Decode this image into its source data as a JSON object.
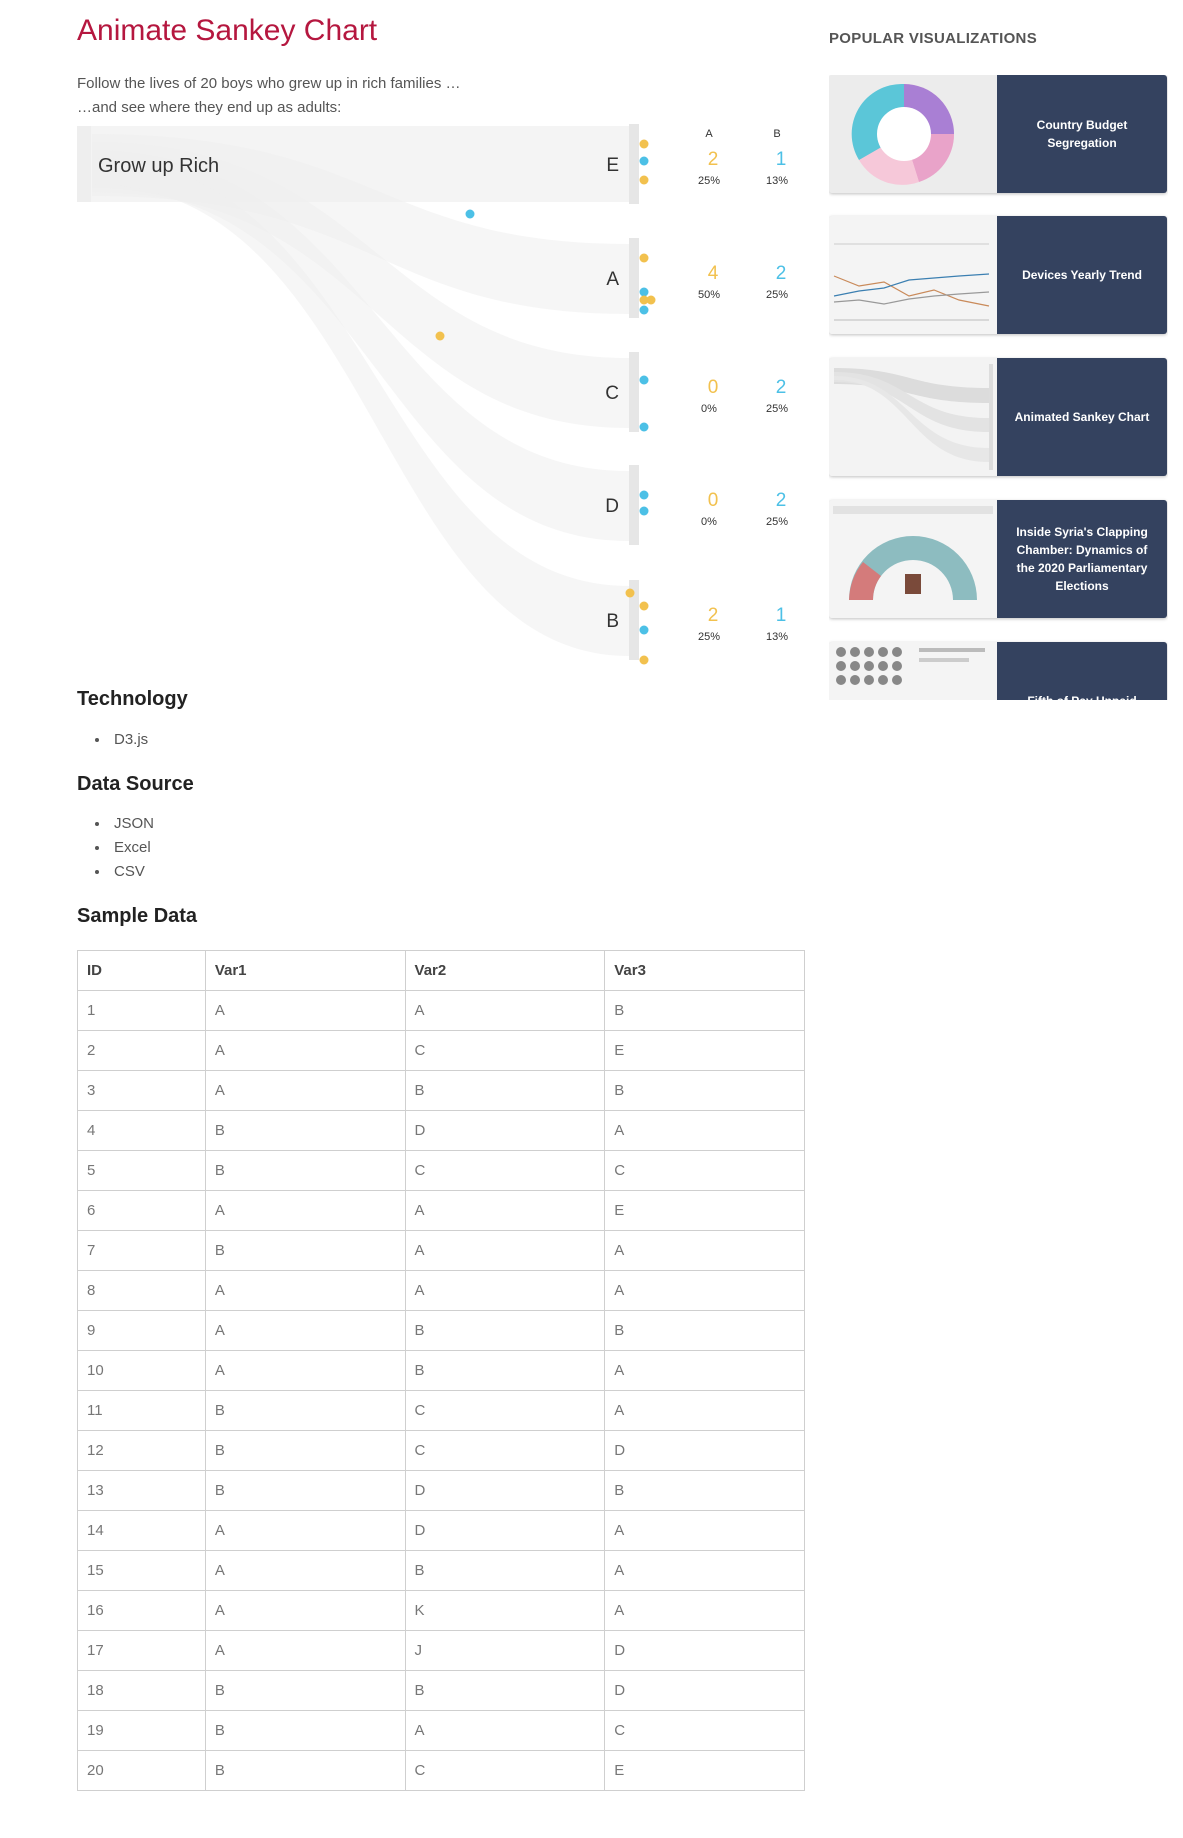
{
  "page": {
    "title": "Animate Sankey Chart",
    "intro_line1": "Follow the lives of 20 boys who grew up in rich families …",
    "intro_line2": "…and see where they end up as adults:"
  },
  "colors": {
    "title": "#b5173f",
    "series_a": "#f2c14e",
    "series_b": "#4cc0e6",
    "card_label_bg": "#34425f"
  },
  "chart_data": {
    "type": "sankey",
    "source": {
      "label": "Grow up Rich"
    },
    "legend": [
      "A",
      "B"
    ],
    "targets": [
      {
        "label": "E",
        "a_count": "2",
        "a_pct": "25%",
        "b_count": "1",
        "b_pct": "13%"
      },
      {
        "label": "A",
        "a_count": "4",
        "a_pct": "50%",
        "b_count": "2",
        "b_pct": "25%"
      },
      {
        "label": "C",
        "a_count": "0",
        "a_pct": "0%",
        "b_count": "2",
        "b_pct": "25%"
      },
      {
        "label": "D",
        "a_count": "0",
        "a_pct": "0%",
        "b_count": "2",
        "b_pct": "25%"
      },
      {
        "label": "B",
        "a_count": "2",
        "a_pct": "25%",
        "b_count": "1",
        "b_pct": "13%"
      }
    ]
  },
  "technology": {
    "heading": "Technology",
    "items": [
      "D3.js"
    ]
  },
  "data_source": {
    "heading": "Data Source",
    "items": [
      "JSON",
      "Excel",
      "CSV"
    ]
  },
  "sample": {
    "heading": "Sample Data",
    "columns": [
      "ID",
      "Var1",
      "Var2",
      "Var3"
    ],
    "rows": [
      [
        "1",
        "A",
        "A",
        "B"
      ],
      [
        "2",
        "A",
        "C",
        "E"
      ],
      [
        "3",
        "A",
        "B",
        "B"
      ],
      [
        "4",
        "B",
        "D",
        "A"
      ],
      [
        "5",
        "B",
        "C",
        "C"
      ],
      [
        "6",
        "A",
        "A",
        "E"
      ],
      [
        "7",
        "B",
        "A",
        "A"
      ],
      [
        "8",
        "A",
        "A",
        "A"
      ],
      [
        "9",
        "A",
        "B",
        "B"
      ],
      [
        "10",
        "A",
        "B",
        "A"
      ],
      [
        "11",
        "B",
        "C",
        "A"
      ],
      [
        "12",
        "B",
        "C",
        "D"
      ],
      [
        "13",
        "B",
        "D",
        "B"
      ],
      [
        "14",
        "A",
        "D",
        "A"
      ],
      [
        "15",
        "A",
        "B",
        "A"
      ],
      [
        "16",
        "A",
        "K",
        "A"
      ],
      [
        "17",
        "A",
        "J",
        "D"
      ],
      [
        "18",
        "B",
        "B",
        "D"
      ],
      [
        "19",
        "B",
        "A",
        "C"
      ],
      [
        "20",
        "B",
        "C",
        "E"
      ]
    ]
  },
  "sidebar": {
    "title": "POPULAR VISUALIZATIONS",
    "cards": [
      {
        "title": "Country Budget Segregation",
        "thumb": "donut"
      },
      {
        "title": "Devices Yearly Trend",
        "thumb": "lines"
      },
      {
        "title": "Animated Sankey Chart",
        "thumb": "sankey"
      },
      {
        "title": "Inside Syria's Clapping Chamber: Dynamics of the 2020 Parliamentary Elections",
        "thumb": "parliament"
      },
      {
        "title": "Fifth of Pay Unpaid",
        "thumb": "grid"
      }
    ]
  }
}
